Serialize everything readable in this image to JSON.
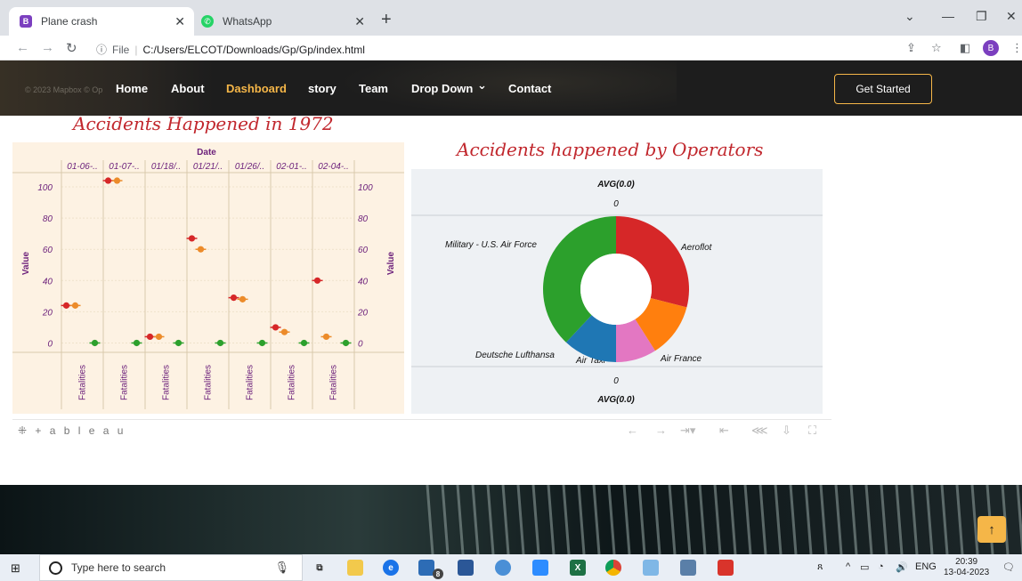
{
  "browser": {
    "tabs": [
      {
        "label": "Plane crash",
        "favicon": "B",
        "favicon_color": "#7b3fbf",
        "active": true
      },
      {
        "label": "WhatsApp",
        "favicon": "✆",
        "favicon_color": "#25d366",
        "active": false
      }
    ],
    "url_prefix": "File",
    "url": "C:/Users/ELCOT/Downloads/Gp/Gp/index.html",
    "profile_initial": "B"
  },
  "site": {
    "map_credit": "© 2023 Mapbox © Op",
    "nav": [
      "Home",
      "About",
      "Dashboard",
      "story",
      "Team",
      "Drop Down",
      "Contact"
    ],
    "active_nav": "Dashboard",
    "dropdown_caret": "⌄",
    "cta": "Get Started",
    "accent_color": "#f5b648"
  },
  "dashboard": {
    "left_title": "Accidents Happened in 1972",
    "right_title": "Accidents happened by Operators",
    "tableau_logo": "⁜ + a b l e a u"
  },
  "chart_data": [
    {
      "type": "scatter",
      "title": "Accidents Happened in 1972",
      "top_axis_label": "Date",
      "categories": [
        "01-06-..",
        "01-07-..",
        "01/18/..",
        "01/21/..",
        "01/26/..",
        "02-01-..",
        "02-04-.."
      ],
      "bottom_labels": [
        "Fatalities",
        "Fatalities",
        "Fatalities",
        "Fatalities",
        "Fatalities",
        "Fatalities",
        "Fatalities"
      ],
      "ylabel": "Value",
      "y_ticks": [
        0,
        20,
        40,
        60,
        80,
        100
      ],
      "ylim": [
        -6,
        108
      ],
      "background": "#fdf2e3",
      "series": [
        {
          "color": "#d62728",
          "values": [
            24,
            104,
            4,
            67,
            29,
            10,
            40
          ]
        },
        {
          "color": "#ec8b2a",
          "values": [
            24,
            104,
            4,
            60,
            28,
            7,
            4
          ]
        },
        {
          "color": "#2ca02c",
          "values": [
            0,
            0,
            0,
            0,
            0,
            0,
            0
          ]
        }
      ]
    },
    {
      "type": "pie",
      "title": "Accidents happened by Operators",
      "top_label": "AVG(0.0)",
      "top_value": "0",
      "bottom_value": "0",
      "bottom_label": "AVG(0.0)",
      "slices": [
        {
          "label": "Aeroflot",
          "value": 29,
          "color": "#d62728"
        },
        {
          "label": "Air France",
          "value": 12,
          "color": "#ff7f0e"
        },
        {
          "label": "Air Taxi",
          "value": 9,
          "color": "#e377c2"
        },
        {
          "label": "Deutsche Lufthansa",
          "value": 12,
          "color": "#1f77b4"
        },
        {
          "label": "Military - U.S. Air Force",
          "value": 38,
          "color": "#2ca02c"
        }
      ]
    }
  ],
  "taskbar": {
    "search_placeholder": "Type here to search",
    "language": "ENG",
    "time": "20:39",
    "date": "13-04-2023",
    "badge": "8"
  }
}
